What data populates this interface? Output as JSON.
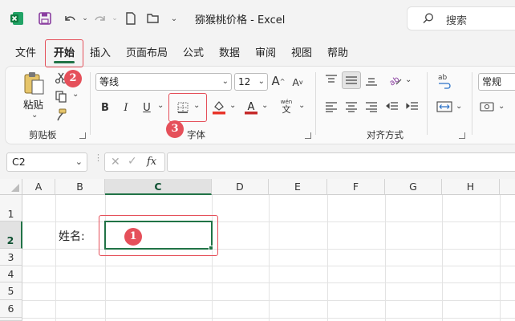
{
  "app": {
    "title": "猕猴桃价格  -  Excel"
  },
  "search": {
    "label": "搜索"
  },
  "tabs": [
    "文件",
    "开始",
    "插入",
    "页面布局",
    "公式",
    "数据",
    "审阅",
    "视图",
    "帮助"
  ],
  "ribbon": {
    "clipboard": {
      "paste_label": "粘贴",
      "group_label": "剪贴板"
    },
    "font": {
      "font_name": "等线",
      "font_size": "12",
      "bold": "B",
      "italic": "I",
      "underline": "U",
      "phonetic_top": "wén",
      "phonetic_bottom": "文",
      "group_label": "字体",
      "fill_color": "#e8352a",
      "font_color": "#c52a2a",
      "grow_label": "A",
      "shrink_label": "A"
    },
    "alignment": {
      "group_label": "对齐方式"
    },
    "number": {
      "format": "常规"
    }
  },
  "formula_bar": {
    "name_box": "C2",
    "fx": "fx",
    "formula": ""
  },
  "grid": {
    "columns": [
      "A",
      "B",
      "C",
      "D",
      "E",
      "F",
      "G",
      "H"
    ],
    "rows": [
      "1",
      "2",
      "3",
      "4",
      "5",
      "6"
    ],
    "cells": {
      "B2": "姓名:",
      "C2": ""
    }
  },
  "annotations": {
    "step1": "1",
    "step2": "2",
    "step3": "3",
    "color": "#e5505a"
  },
  "colors": {
    "accent": "#217346",
    "selection": "#217346"
  }
}
